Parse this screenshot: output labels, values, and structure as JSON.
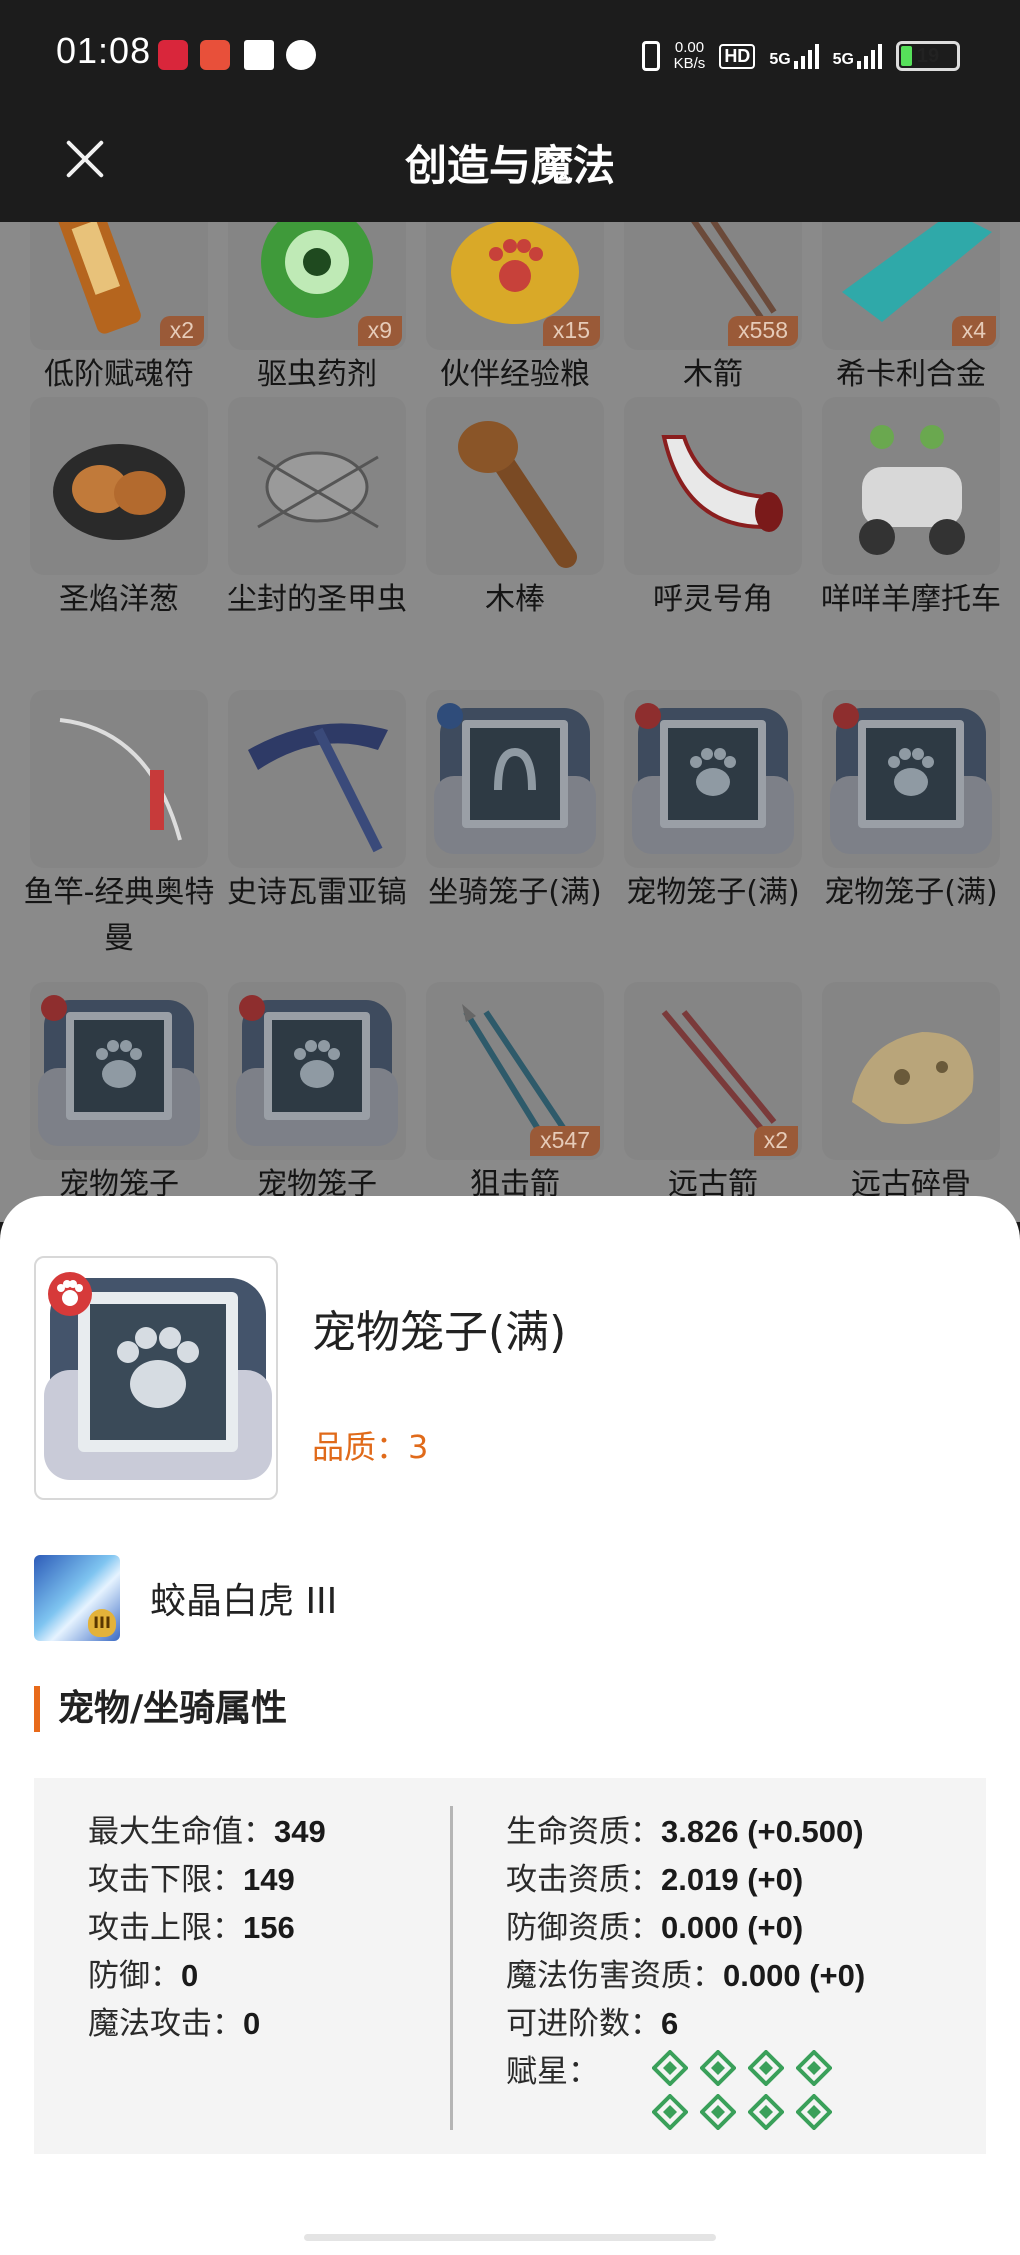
{
  "status_bar": {
    "time": "01:08",
    "app_icons": [
      "small-red-app-icon",
      "red-app-icon",
      "white-square-icon",
      "chat-bubble-icon"
    ],
    "network_speed": "0.00",
    "network_unit": "KB/s",
    "hd_label": "HD",
    "signal_1": "5G",
    "signal_2": "5G",
    "battery": "19"
  },
  "header": {
    "title": "创造与魔法",
    "close_icon": "close-icon"
  },
  "grid": {
    "rows": [
      [
        {
          "name": "低阶赋魂符",
          "count": "x2",
          "icon": "talisman"
        },
        {
          "name": "驱虫药剂",
          "count": "x9",
          "icon": "green-potion"
        },
        {
          "name": "伙伴经验粮",
          "count": "x15",
          "icon": "food-bag"
        },
        {
          "name": "木箭",
          "count": "x558",
          "icon": "arrows"
        },
        {
          "name": "希卡利合金",
          "count": "x4",
          "icon": "alloy"
        }
      ],
      [
        {
          "name": "圣焰洋葱",
          "count": "",
          "icon": "onion"
        },
        {
          "name": "尘封的圣甲虫",
          "count": "",
          "icon": "beetle"
        },
        {
          "name": "木棒",
          "count": "",
          "icon": "club"
        },
        {
          "name": "呼灵号角",
          "count": "",
          "icon": "horn"
        },
        {
          "name": "咩咩羊摩托车",
          "count": "",
          "icon": "scooter"
        }
      ],
      [
        {
          "name": "鱼竿-经典奥特曼",
          "count": "",
          "icon": "fishing-rod"
        },
        {
          "name": "史诗瓦雷亚镐",
          "count": "",
          "icon": "pickaxe"
        },
        {
          "name": "坐骑笼子(满)",
          "count": "",
          "icon": "mount-cage"
        },
        {
          "name": "宠物笼子(满)",
          "count": "",
          "icon": "pet-cage"
        },
        {
          "name": "宠物笼子(满)",
          "count": "",
          "icon": "pet-cage"
        }
      ],
      [
        {
          "name": "宠物笼子",
          "count": "",
          "icon": "pet-cage"
        },
        {
          "name": "宠物笼子",
          "count": "",
          "icon": "pet-cage"
        },
        {
          "name": "狙击箭",
          "count": "x547",
          "icon": "sniper-arrows"
        },
        {
          "name": "远古箭",
          "count": "x2",
          "icon": "ancient-arrows"
        },
        {
          "name": "远古碎骨",
          "count": "",
          "icon": "bone"
        }
      ]
    ]
  },
  "detail": {
    "item_name": "宠物笼子(满)",
    "quality_label": "品质：3",
    "pet_name": "蛟晶白虎 III",
    "pet_rank": "III",
    "section_title": "宠物/坐骑属性",
    "left_attrs": [
      {
        "label": "最大生命值：",
        "value": "349"
      },
      {
        "label": "攻击下限：",
        "value": "149"
      },
      {
        "label": "攻击上限：",
        "value": "156"
      },
      {
        "label": "防御：",
        "value": "0"
      },
      {
        "label": "魔法攻击：",
        "value": "0"
      }
    ],
    "right_attrs": [
      {
        "label": "生命资质：",
        "value": "3.826 (+0.500)"
      },
      {
        "label": "攻击资质：",
        "value": "2.019 (+0)"
      },
      {
        "label": "防御资质：",
        "value": "0.000 (+0)"
      },
      {
        "label": "魔法伤害资质：",
        "value": "0.000 (+0)"
      },
      {
        "label": "可进阶数：",
        "value": "6"
      },
      {
        "label": "赋星：",
        "value": ""
      }
    ],
    "star_slots": 8,
    "star_color": "#3aa05a"
  }
}
